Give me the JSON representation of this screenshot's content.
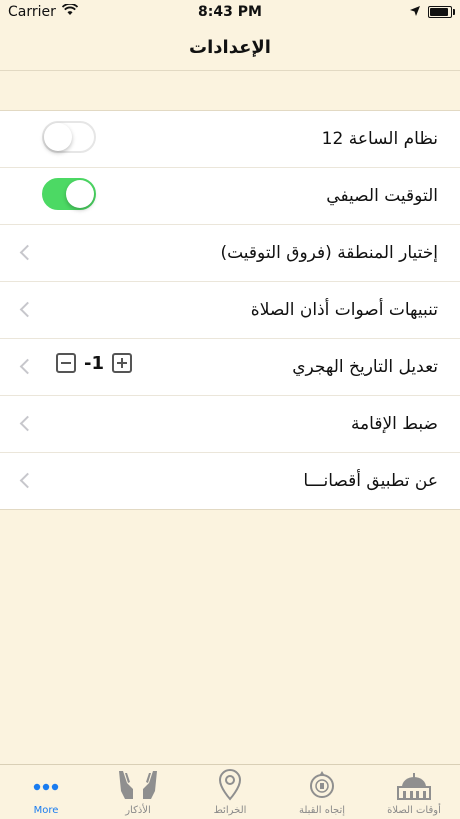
{
  "status_bar": {
    "carrier": "Carrier",
    "time": "8:43 PM"
  },
  "nav": {
    "title": "الإعدادات"
  },
  "settings": {
    "items": [
      {
        "label": "نظام الساعة 12",
        "control": "switch",
        "state": "off"
      },
      {
        "label": "التوقيت الصيفي",
        "control": "switch",
        "state": "on"
      },
      {
        "label": "إختيار المنطقة (فروق التوقيت)",
        "control": "chevron"
      },
      {
        "label": "تنبيهات أصوات أذان الصلاة",
        "control": "chevron"
      },
      {
        "label": "تعديل التاريخ الهجري",
        "control": "stepper",
        "value": "-1"
      },
      {
        "label": "ضبط الإقامة",
        "control": "chevron"
      },
      {
        "label": "عن تطبيق أقصانـــا",
        "control": "chevron"
      }
    ]
  },
  "tab_bar": {
    "tabs": [
      {
        "label": "More",
        "icon": "more-icon",
        "active": true
      },
      {
        "label": "الأذكار",
        "icon": "praying-hands-icon",
        "active": false
      },
      {
        "label": "الخرائط",
        "icon": "map-pin-icon",
        "active": false
      },
      {
        "label": "إتجاه القبلة",
        "icon": "compass-icon",
        "active": false
      },
      {
        "label": "أوقات الصلاة",
        "icon": "mosque-icon",
        "active": false
      }
    ]
  },
  "colors": {
    "background": "#fbf3df",
    "switch_on": "#4cd964",
    "tab_active": "#1a7cf0",
    "tab_inactive": "#8a8a8a"
  }
}
